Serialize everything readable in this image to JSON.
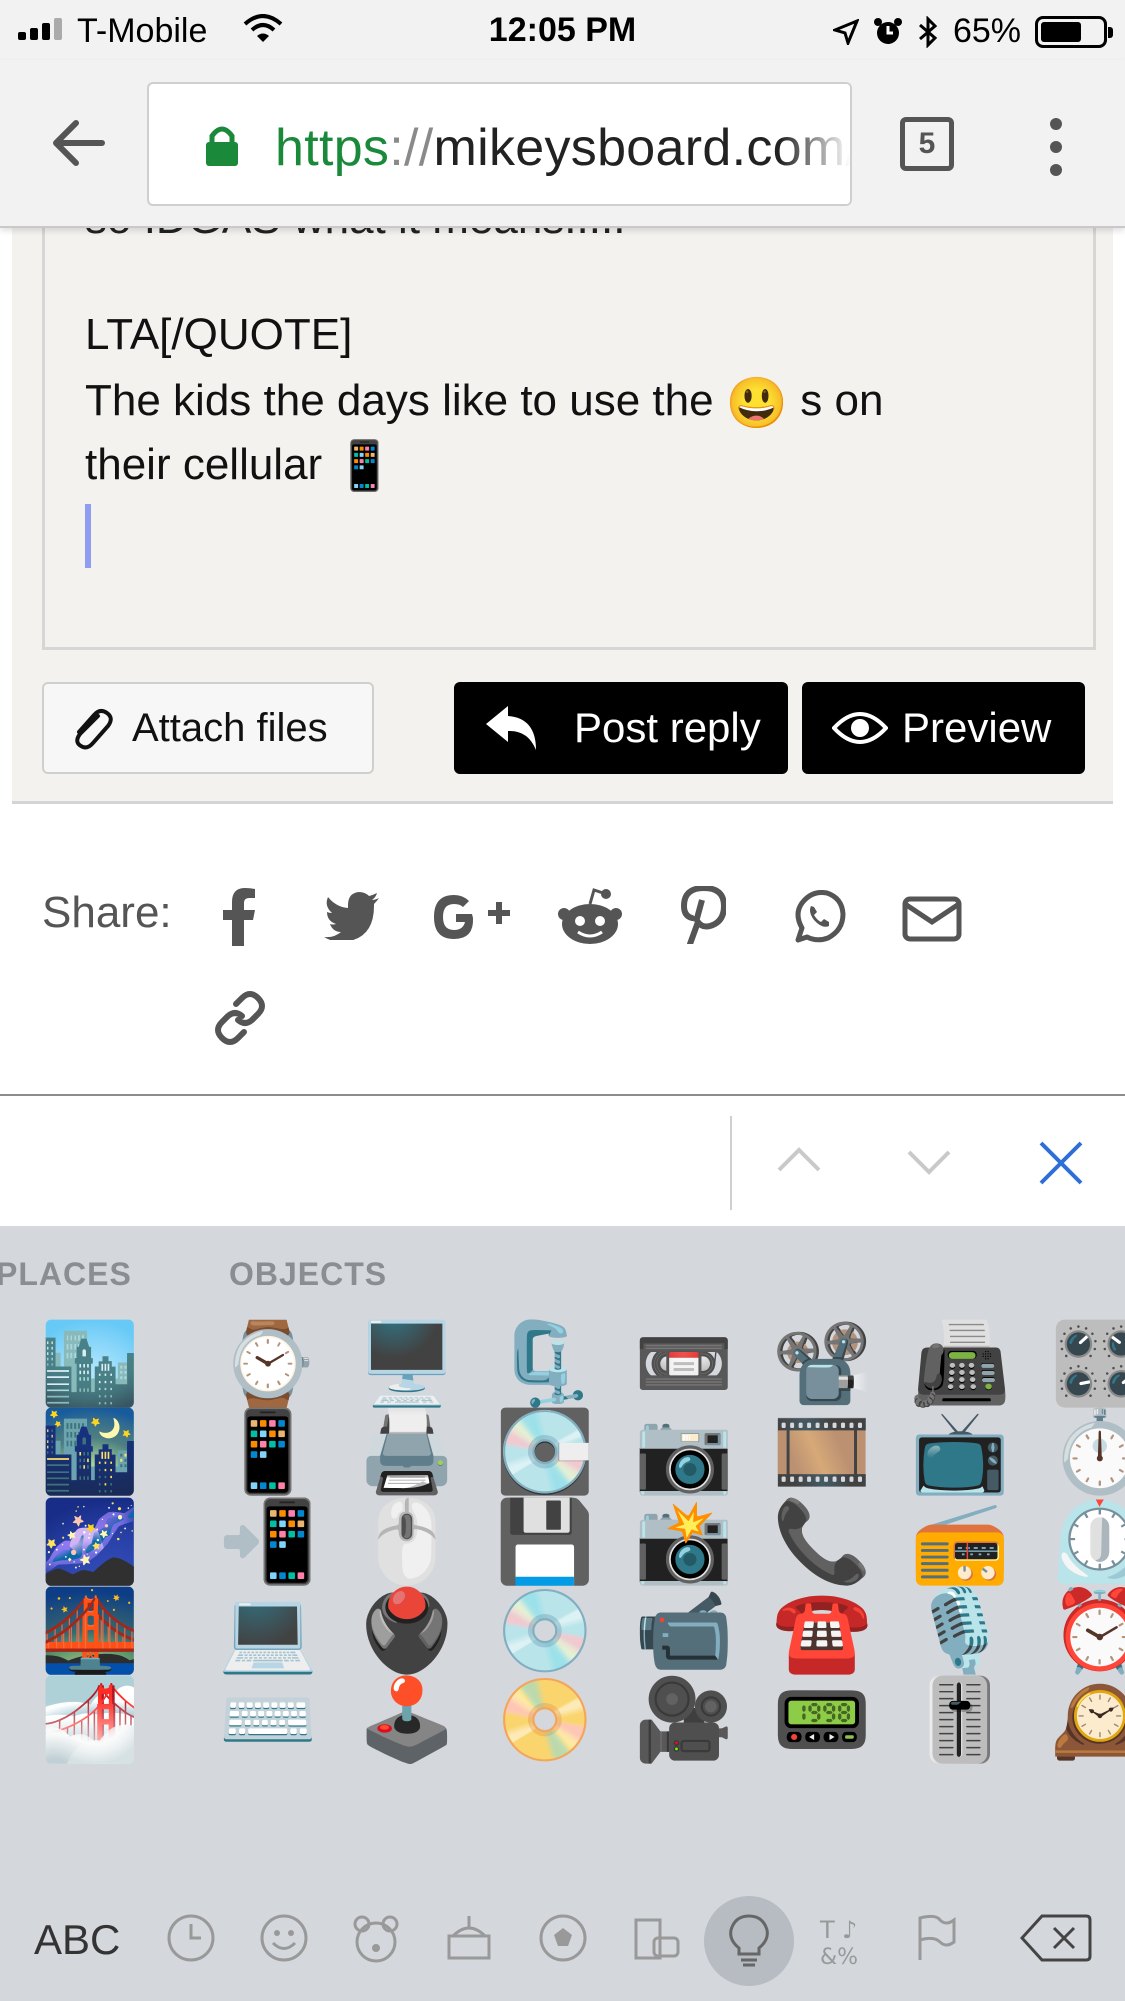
{
  "status_bar": {
    "carrier": "T-Mobile",
    "time": "12:05 PM",
    "battery": "65%",
    "battery_level": 0.65
  },
  "browser": {
    "url_scheme": "https",
    "url_sep": "://",
    "url_host": "mikeysboard.com/t",
    "tab_count": "5"
  },
  "editor": {
    "cut_line": "so IDGAS what it means.....",
    "quote_end": "LTA[/QUOTE]",
    "line1_before": "The kids the days like to use the ",
    "line1_after": " s on",
    "line2": "their cellular "
  },
  "buttons": {
    "attach": "Attach files",
    "post": "Post reply",
    "preview": "Preview"
  },
  "share": {
    "label": "Share:",
    "icons": [
      "facebook-icon",
      "twitter-icon",
      "google-plus-icon",
      "reddit-icon",
      "pinterest-icon",
      "whatsapp-icon",
      "email-icon",
      "link-icon"
    ]
  },
  "keyboard": {
    "category_places": "PLACES",
    "category_objects": "OBJECTS",
    "abc": "ABC",
    "places_emojis": [
      "🏙️",
      "🌃",
      "🌌",
      "🌉",
      "🌁"
    ],
    "objects_columns": [
      [
        "⌚",
        "📱",
        "📲",
        "💻",
        "⌨️"
      ],
      [
        "🖥️",
        "🖨️",
        "🖱️",
        "🖲️",
        "🕹️"
      ],
      [
        "🗜️",
        "💽",
        "💾",
        "💿",
        "📀"
      ],
      [
        "📼",
        "📷",
        "📸",
        "📹",
        "🎥"
      ],
      [
        "📽️",
        "🎞️",
        "📞",
        "☎️",
        "📟"
      ],
      [
        "📠",
        "📺",
        "📻",
        "🎙️",
        "🎚️"
      ],
      [
        "🎛️",
        "⏱️",
        "⏲️",
        "⏰",
        "🕰️"
      ]
    ],
    "selected_category": "objects"
  }
}
